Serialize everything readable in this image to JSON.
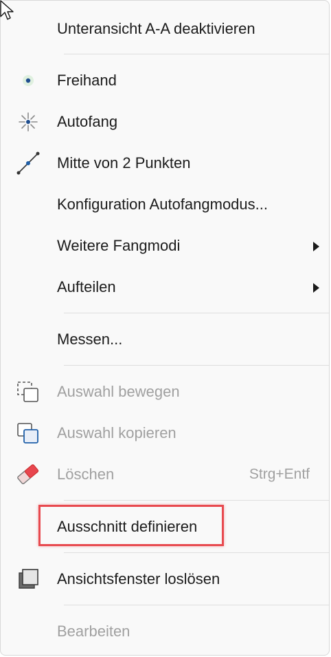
{
  "menu": {
    "items": [
      {
        "id": "unteransicht",
        "label": "Unteransicht A-A deaktivieren",
        "icon": "",
        "enabled": true
      },
      {
        "id": "freihand",
        "label": "Freihand",
        "icon": "freehand-point-icon",
        "enabled": true
      },
      {
        "id": "autofang",
        "label": "Autofang",
        "icon": "autosnap-icon",
        "enabled": true
      },
      {
        "id": "mitte",
        "label": "Mitte von 2 Punkten",
        "icon": "midpoint-icon",
        "enabled": true
      },
      {
        "id": "konfiguration",
        "label": "Konfiguration Autofangmodus...",
        "icon": "",
        "enabled": true
      },
      {
        "id": "weitere",
        "label": "Weitere Fangmodi",
        "icon": "",
        "enabled": true,
        "submenu": true
      },
      {
        "id": "aufteilen",
        "label": "Aufteilen",
        "icon": "",
        "enabled": true,
        "submenu": true
      },
      {
        "id": "messen",
        "label": "Messen...",
        "icon": "",
        "enabled": true
      },
      {
        "id": "auswahl_bewegen",
        "label": "Auswahl bewegen",
        "icon": "move-selection-icon",
        "enabled": false
      },
      {
        "id": "auswahl_kopieren",
        "label": "Auswahl kopieren",
        "icon": "copy-selection-icon",
        "enabled": false
      },
      {
        "id": "loeschen",
        "label": "Löschen",
        "shortcut": "Strg+Entf",
        "icon": "eraser-icon",
        "enabled": false
      },
      {
        "id": "ausschnitt",
        "label": "Ausschnitt definieren",
        "icon": "",
        "enabled": true,
        "highlighted": true
      },
      {
        "id": "ansichtsfenster",
        "label": "Ansichtsfenster loslösen",
        "icon": "detach-window-icon",
        "enabled": true
      },
      {
        "id": "bearbeiten",
        "label": "Bearbeiten",
        "icon": "",
        "enabled": false
      }
    ]
  },
  "colors": {
    "highlight_border": "#e84a4f",
    "accent_blue": "#1f5fa8",
    "disabled_text": "#a0a0a0"
  }
}
